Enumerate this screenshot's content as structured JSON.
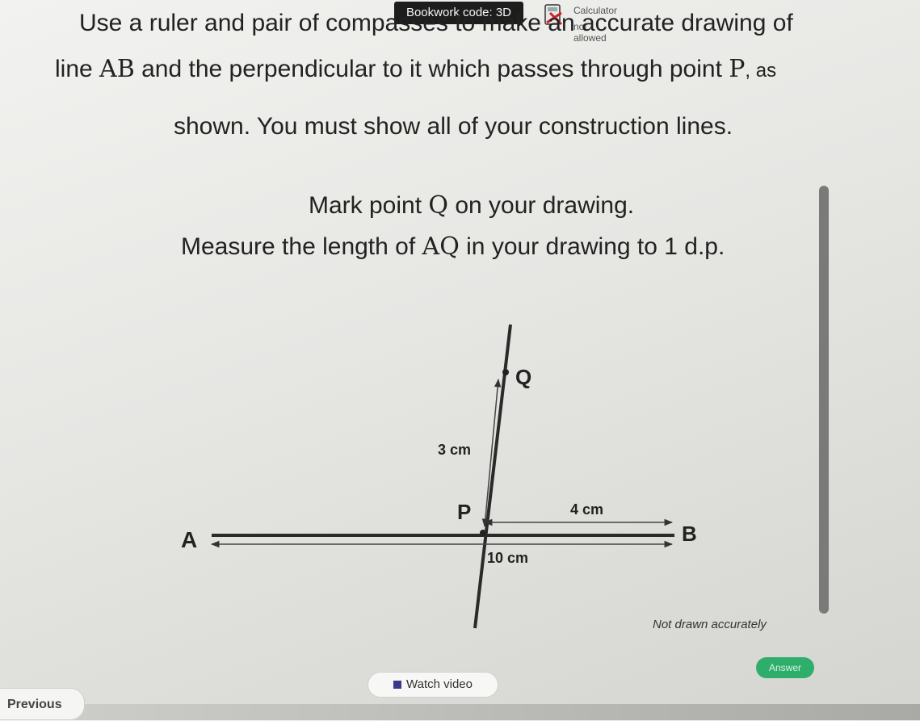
{
  "header": {
    "bookwork_code": "Bookwork code: 3D",
    "calculator_title": "Calculator",
    "calculator_status": "not allowed"
  },
  "question": {
    "line1": "Use a ruler and pair of compasses to make an accurate drawing of",
    "line2_pre": "line ",
    "line2_math": "AB",
    "line2_post": " and the perpendicular to it which passes through point ",
    "line2_math2": "P",
    "line2_end": ", as",
    "line3": "shown. You must show all of your construction lines.",
    "line4_pre": "Mark point ",
    "line4_math": "Q",
    "line4_post": " on your drawing.",
    "line5_pre": "Measure the length of ",
    "line5_math": "AQ",
    "line5_post": " in your drawing to 1 d.p."
  },
  "diagram": {
    "label_a": "A",
    "label_b": "B",
    "label_p": "P",
    "label_q": "Q",
    "dim_pq": "3 cm",
    "dim_pb": "4 cm",
    "dim_ab": "10 cm",
    "note": "Not drawn accurately"
  },
  "buttons": {
    "watch_video": "Watch video",
    "previous": "Previous",
    "answer": "Answer"
  },
  "colors": {
    "badge": "#1d1d1d",
    "answer": "#2fae6b"
  }
}
